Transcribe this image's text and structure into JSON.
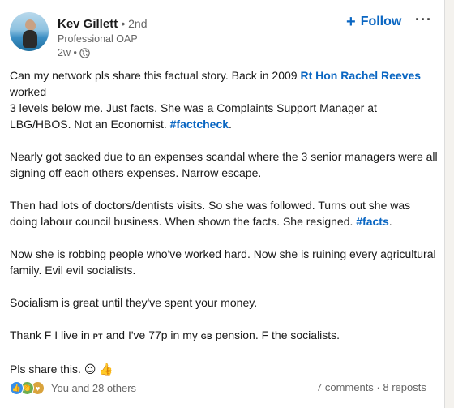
{
  "author": {
    "name": "Kev Gillett",
    "degree": "• 2nd",
    "headline": "Professional OAP",
    "time": "2w •"
  },
  "actions": {
    "follow_label": "Follow",
    "more_label": "···"
  },
  "post": {
    "p1_a": "Can my network pls share this factual story. Back in 2009 ",
    "p1_mention": "Rt Hon Rachel Reeves",
    "p1_b": " worked",
    "p1_c": "3 levels below me. Just facts. She was a Complaints Support Manager at LBG/HBOS. Not an Economist. ",
    "p1_tag": "#factcheck",
    "p1_end": ".",
    "p2": "Nearly got sacked due to an expenses scandal where the 3 senior managers were all signing off each others expenses. Narrow escape.",
    "p3_a": "Then had lots of doctors/dentists visits. So she was followed. Turns out she was doing labour council business. When shown the facts. She resigned. ",
    "p3_tag": "#facts",
    "p3_end": ".",
    "p4": "Now she is robbing people who've worked hard. Now she is ruining every agricultural family. Evil evil socialists.",
    "p5": "Socialism is great until they've spent your money.",
    "p6_a": "Thank F I live in ",
    "p6_pt": "PT",
    "p6_b": " and I've 77p in my ",
    "p6_gb": "GB",
    "p6_c": " pension. F the socialists.",
    "p7": "Pls share this. 😉 👍"
  },
  "social": {
    "reactions_text": "You and 28 others",
    "stats_text": "7 comments · 8 reposts"
  },
  "colors": {
    "link": "#0a66c2",
    "muted": "#666666"
  }
}
